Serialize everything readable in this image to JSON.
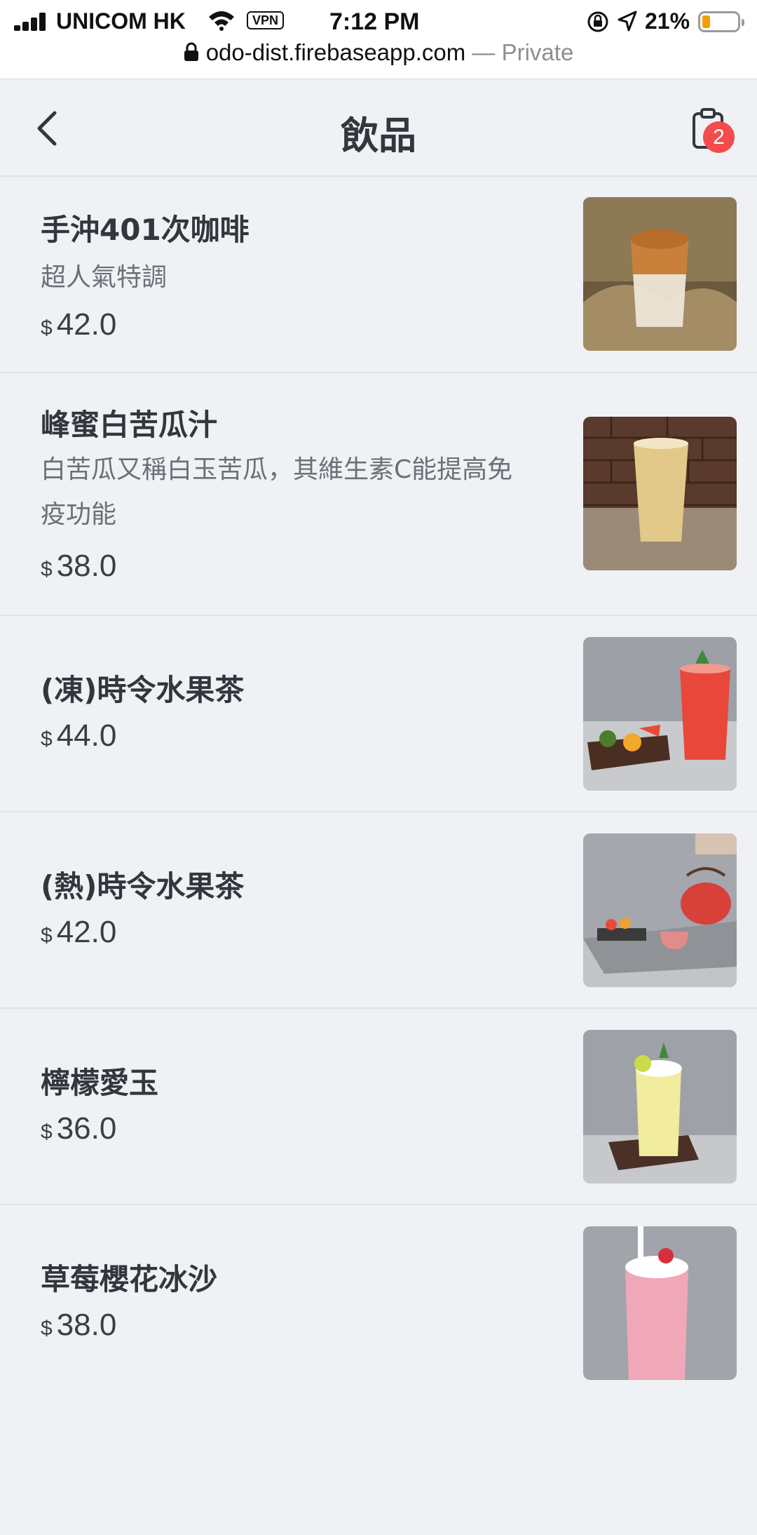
{
  "status_bar": {
    "carrier": "UNICOM HK",
    "vpn": "VPN",
    "time": "7:12 PM",
    "battery": "21%",
    "battery_color": "#f0a000"
  },
  "url_bar": {
    "domain": "odo-dist.firebaseapp.com",
    "mode": "— Private"
  },
  "nav": {
    "title": "飲品",
    "back_icon": "chevron-left-icon",
    "cart_icon": "clipboard-icon",
    "cart_count": "2",
    "badge_color": "#f44b4b"
  },
  "menu": {
    "items": [
      {
        "name": "手沖401次咖啡",
        "desc": "超人氣特調",
        "currency": "$",
        "price": "42.0",
        "image": "iced-coffee-photo"
      },
      {
        "name": "峰蜜白苦瓜汁",
        "desc": "白苦瓜又稱白玉苦瓜，其維生素C能提高免疫功能",
        "currency": "$",
        "price": "38.0",
        "image": "bitter-melon-juice-photo"
      },
      {
        "name": "(凍)時令水果茶",
        "desc": "",
        "currency": "$",
        "price": "44.0",
        "image": "iced-fruit-tea-photo"
      },
      {
        "name": "(熱)時令水果茶",
        "desc": "",
        "currency": "$",
        "price": "42.0",
        "image": "hot-fruit-tea-photo"
      },
      {
        "name": "檸檬愛玉",
        "desc": "",
        "currency": "$",
        "price": "36.0",
        "image": "lemon-aiyu-photo"
      },
      {
        "name": "草莓櫻花冰沙",
        "desc": "",
        "currency": "$",
        "price": "38.0",
        "image": "strawberry-sakura-smoothie-photo"
      }
    ]
  }
}
